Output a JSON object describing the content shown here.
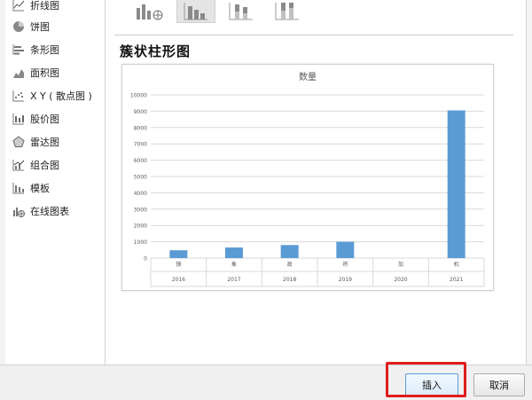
{
  "sidebar": {
    "items": [
      {
        "label": "折线图",
        "icon": "line-chart-icon"
      },
      {
        "label": "饼图",
        "icon": "pie-chart-icon"
      },
      {
        "label": "条形图",
        "icon": "bar-chart-icon"
      },
      {
        "label": "面积图",
        "icon": "area-chart-icon"
      },
      {
        "label": "X Y ( 散点图 )",
        "icon": "scatter-chart-icon"
      },
      {
        "label": "股价图",
        "icon": "stock-chart-icon"
      },
      {
        "label": "雷达图",
        "icon": "radar-chart-icon"
      },
      {
        "label": "组合图",
        "icon": "combo-chart-icon"
      },
      {
        "label": "模板",
        "icon": "template-icon"
      },
      {
        "label": "在线图表",
        "icon": "online-chart-icon"
      }
    ]
  },
  "main": {
    "subtype_title": "簇状柱形图"
  },
  "footer": {
    "insert_label": "插入",
    "cancel_label": "取消"
  },
  "colors": {
    "bar": "#5b9bd5",
    "highlight": "#e11d1d"
  },
  "chart_data": {
    "type": "bar",
    "title": "数量",
    "categories": [
      "镜",
      "象",
      "政",
      "将",
      "加",
      "机"
    ],
    "years": [
      "2016",
      "2017",
      "2018",
      "2019",
      "2020",
      "2021"
    ],
    "values": [
      480,
      650,
      800,
      1000,
      0,
      9050
    ],
    "yticks": [
      0,
      1000,
      2000,
      3000,
      4000,
      5000,
      6000,
      7000,
      8000,
      9000,
      10000
    ],
    "ylim": [
      0,
      10000
    ],
    "grid": true
  }
}
